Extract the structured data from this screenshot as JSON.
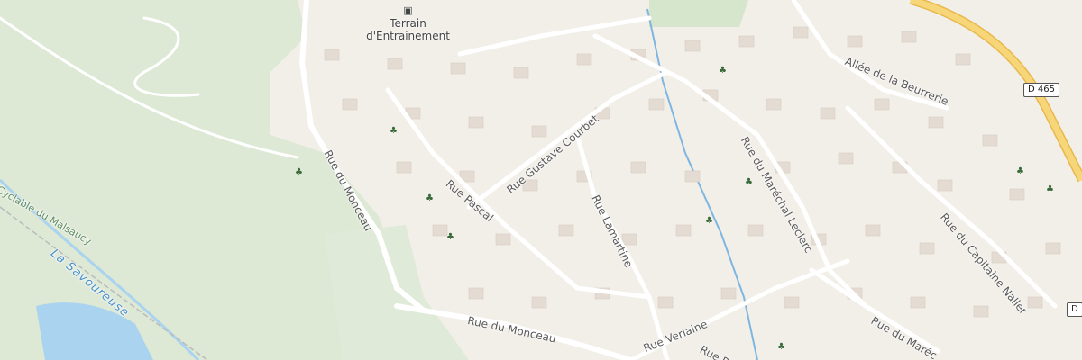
{
  "map": {
    "poi": {
      "name_line1": "Terrain",
      "name_line2": "d'Entrainement"
    },
    "roads": {
      "rue_du_monceau_vertical": "Rue du Monceau",
      "rue_du_monceau_bottom": "Rue du Monceau",
      "rue_pascal": "Rue Pascal",
      "rue_gustave_courbet": "Rue Gustave Courbet",
      "rue_lamartine": "Rue Lamartine",
      "rue_du_marechal_leclerc": "Rue du Maréchal Leclerc",
      "allee_de_la_beurrerie": "Allée de la Beurrerie",
      "rue_du_capitaine_naller": "Rue du Capitaine Naller",
      "rue_verlaine": "Rue Verlaine",
      "rue_du_mare": "Rue du Maréc",
      "rue_p_bottom": "Rue P"
    },
    "cycle_path": "Cyclable du Malsaucy",
    "river": "La Savoureuse",
    "shields": [
      "D 465",
      "D"
    ],
    "colors": {
      "background": "#f2efe9",
      "park": "#dde8d5",
      "building": "#e4dcd3",
      "water": "#a9d3ee",
      "road_major": "#f7d67a"
    }
  }
}
